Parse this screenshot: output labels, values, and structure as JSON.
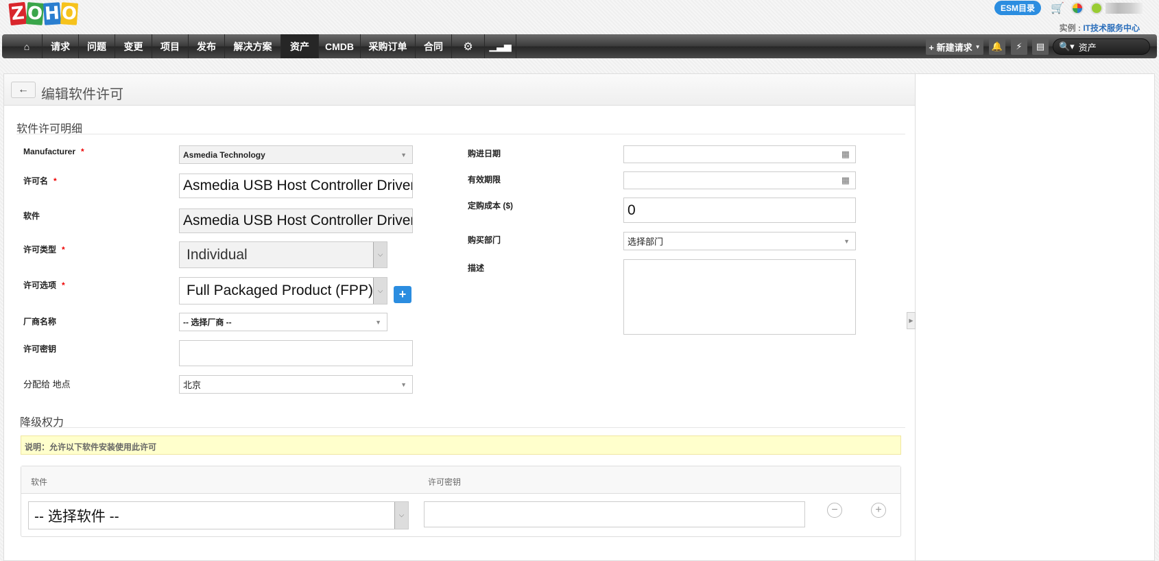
{
  "logo": {
    "letters": [
      "Z",
      "O",
      "H",
      "O"
    ],
    "colors": [
      "#d9262c",
      "#3aa54a",
      "#2a7ecf",
      "#f6c21c"
    ]
  },
  "header": {
    "esm_label": "ESM目录",
    "instance_prefix": "实例 : ",
    "instance_name": "IT技术服务中心"
  },
  "nav": {
    "items": [
      "请求",
      "问题",
      "变更",
      "项目",
      "发布",
      "解决方案",
      "资产",
      "CMDB",
      "采购订单",
      "合同"
    ],
    "active": "资产",
    "new_request": "+ 新建请求",
    "search_value": "资产"
  },
  "page": {
    "title": "编辑软件许可",
    "section1": "软件许可明细",
    "section2": "降级权力"
  },
  "form": {
    "manufacturer": {
      "label": "Manufacturer",
      "value": "Asmedia Technology"
    },
    "license_name": {
      "label": "许可名",
      "value": "Asmedia USB Host Controller Driver"
    },
    "software": {
      "label": "软件",
      "value": "Asmedia USB Host Controller Driver"
    },
    "license_type": {
      "label": "许可类型",
      "value": "Individual"
    },
    "license_option": {
      "label": "许可选项",
      "value": "Full Packaged Product (FPP)"
    },
    "vendor": {
      "label": "厂商名称",
      "value": "-- 选择厂商 --"
    },
    "license_key": {
      "label": "许可密钥",
      "value": ""
    },
    "site": {
      "label": "分配给 地点",
      "value": "北京"
    },
    "purchase_date": {
      "label": "购进日期",
      "value": ""
    },
    "expiry_date": {
      "label": "有效期限",
      "value": ""
    },
    "cost": {
      "label": "定购成本 ($)",
      "value": "0"
    },
    "department": {
      "label": "购买部门",
      "value": "选择部门"
    },
    "description": {
      "label": "描述",
      "value": ""
    }
  },
  "downgrade": {
    "note": "说明：允许以下软件安装使用此许可",
    "col_software": "软件",
    "col_key": "许可密钥",
    "row": {
      "software": "-- 选择软件 --",
      "key": ""
    }
  }
}
